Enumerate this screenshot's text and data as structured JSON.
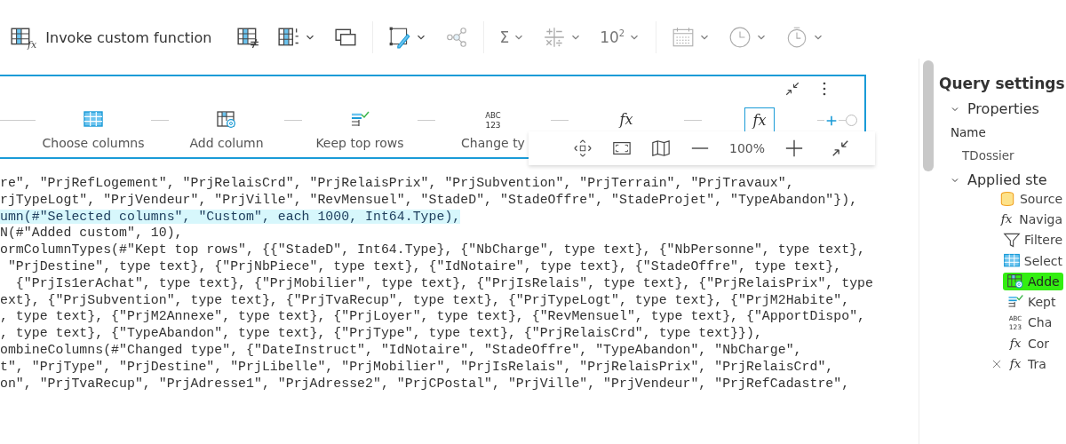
{
  "toolbar": {
    "items": [
      {
        "kind": "invoke-function",
        "label": "Invoke custom function",
        "glyph": "fx",
        "caret": false,
        "disabled": false
      },
      {
        "kind": "conditional",
        "caret": false,
        "disabled": false
      },
      {
        "kind": "index",
        "caret": true,
        "disabled": false
      },
      {
        "kind": "duplicate",
        "caret": false,
        "disabled": false
      },
      {
        "kind": "format",
        "caret": true,
        "disabled": false,
        "divider_before": true
      },
      {
        "kind": "network",
        "caret": false,
        "disabled": true
      },
      {
        "kind": "statistics",
        "glyph": "Σ",
        "caret": true,
        "disabled": true,
        "divider_before": true
      },
      {
        "kind": "standard",
        "caret": true,
        "disabled": true
      },
      {
        "kind": "scientific",
        "glyph": "10$^{2}$",
        "caret": true,
        "disabled": true
      },
      {
        "kind": "date",
        "caret": true,
        "disabled": true,
        "divider_before": true
      },
      {
        "kind": "time",
        "caret": true,
        "disabled": true
      },
      {
        "kind": "duration",
        "caret": true,
        "disabled": true
      }
    ]
  },
  "diagram": {
    "steps": [
      {
        "kind": "table",
        "label": "Choose columns",
        "selected": false
      },
      {
        "kind": "add-column",
        "label": "Add column",
        "selected": false
      },
      {
        "kind": "keep-rows",
        "label": "Keep top rows",
        "selected": false
      },
      {
        "kind": "type",
        "glyph": "ABC",
        "glyph_2": "123",
        "label": "Change ty",
        "selected": false
      },
      {
        "kind": "fx",
        "glyph": "fx",
        "selected": false
      },
      {
        "kind": "fx",
        "glyph": "fx",
        "selected": true
      }
    ],
    "zoom": "100%"
  },
  "code": {
    "lines": [
      {
        "text": "re\", \"PrjRefLogement\", \"PrjRelaisCrd\", \"PrjRelaisPrix\", \"PrjSubvention\", \"PrjTerrain\", \"PrjTravaux\",",
        "highlighted": false
      },
      {
        "text": "rjTypeLogt\", \"PrjVendeur\", \"PrjVille\", \"RevMensuel\", \"StadeD\", \"StadeOffre\", \"StadeProjet\", \"TypeAbandon\"}),",
        "highlighted": false
      },
      {
        "text": "umn(#\"Selected columns\", \"Custom\", each 1000, Int64.Type),",
        "highlighted": true
      },
      {
        "text": "N(#\"Added custom\", 10),",
        "highlighted": false
      },
      {
        "text": "ormColumnTypes(#\"Kept top rows\", {{\"StadeD\", Int64.Type}, {\"NbCharge\", type text}, {\"NbPersonne\", type text},",
        "highlighted": false
      },
      {
        "text": " \"PrjDestine\", type text}, {\"PrjNbPiece\", type text}, {\"IdNotaire\", type text}, {\"StadeOffre\", type text},",
        "highlighted": false
      },
      {
        "text": "  {\"PrjIs1erAchat\", type text}, {\"PrjMobilier\", type text}, {\"PrjIsRelais\", type text}, {\"PrjRelaisPrix\", type",
        "highlighted": false
      },
      {
        "text": "ext}, {\"PrjSubvention\", type text}, {\"PrjTvaRecup\", type text}, {\"PrjTypeLogt\", type text}, {\"PrjM2Habite\",",
        "highlighted": false
      },
      {
        "text": ", type text}, {\"PrjM2Annexe\", type text}, {\"PrjLoyer\", type text}, {\"RevMensuel\", type text}, {\"ApportDispo\",",
        "highlighted": false
      },
      {
        "text": ", type text}, {\"TypeAbandon\", type text}, {\"PrjType\", type text}, {\"PrjRelaisCrd\", type text}}),",
        "highlighted": false
      },
      {
        "text": "ombineColumns(#\"Changed type\", {\"DateInstruct\", \"IdNotaire\", \"StadeOffre\", \"TypeAbandon\", \"NbCharge\",",
        "highlighted": false
      },
      {
        "text": "t\", \"PrjType\", \"PrjDestine\", \"PrjLibelle\", \"PrjMobilier\", \"PrjIsRelais\", \"PrjRelaisPrix\", \"PrjRelaisCrd\",",
        "highlighted": false
      },
      {
        "text": "on\", \"PrjTvaRecup\", \"PrjAdresse1\", \"PrjAdresse2\", \"PrjCPostal\", \"PrjVille\", \"PrjVendeur\", \"PrjRefCadastre\",",
        "highlighted": false
      }
    ]
  },
  "query_settings": {
    "title": "Query settings",
    "properties": {
      "heading": "Properties",
      "expanded": true,
      "name_label": "Name",
      "name_value": "TDossier"
    },
    "applied_steps": {
      "heading": "Applied ste",
      "expanded": true,
      "steps": [
        {
          "kind": "source",
          "label": "Source",
          "selected": false,
          "deletable": false
        },
        {
          "kind": "fx",
          "glyph": "fx",
          "label": "Naviga",
          "selected": false,
          "deletable": false
        },
        {
          "kind": "filter",
          "label": "Filtere",
          "selected": false,
          "deletable": false
        },
        {
          "kind": "table",
          "label": "Select",
          "selected": false,
          "deletable": false
        },
        {
          "kind": "add-column",
          "label": "Adde",
          "selected": true,
          "deletable": false
        },
        {
          "kind": "keep-rows",
          "label": "Kept",
          "selected": false,
          "deletable": false
        },
        {
          "kind": "type",
          "glyph": "ABC",
          "glyph_2": "123",
          "label": "Cha",
          "selected": false,
          "deletable": false
        },
        {
          "kind": "fx",
          "glyph": "fx",
          "label": "Cor",
          "selected": false,
          "deletable": false
        },
        {
          "kind": "fx",
          "glyph": "fx",
          "label": "Tra",
          "selected": false,
          "deletable": true
        }
      ]
    }
  }
}
